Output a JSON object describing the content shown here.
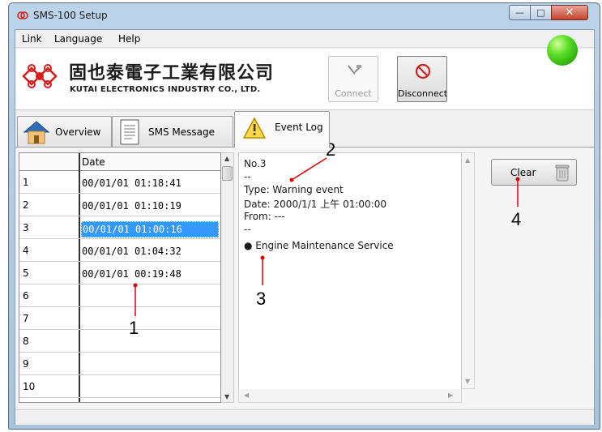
{
  "window": {
    "title": "SMS-100 Setup",
    "close_glyph": "✕",
    "min_glyph": "—",
    "max_glyph": "□"
  },
  "menu": {
    "items": [
      "Link",
      "Language",
      "Help"
    ]
  },
  "header": {
    "company_cn": "固也泰電子工業有限公司",
    "company_en": "KUTAI ELECTRONICS INDUSTRY CO., LTD.",
    "connect_label": "Connect",
    "disconnect_label": "Disconnect",
    "status_color": "#3fd11a"
  },
  "tabs": [
    {
      "label": "Overview",
      "icon": "house-icon"
    },
    {
      "label": "SMS Message",
      "icon": "document-icon"
    },
    {
      "label": "Event Log",
      "icon": "warning-icon",
      "active": true
    }
  ],
  "grid": {
    "column_header": "Date",
    "rows": [
      {
        "num": "1",
        "date": "00/01/01 01:18:41"
      },
      {
        "num": "2",
        "date": "00/01/01 01:10:19"
      },
      {
        "num": "3",
        "date": "00/01/01 01:00:16",
        "selected": true
      },
      {
        "num": "4",
        "date": "00/01/01 01:04:32"
      },
      {
        "num": "5",
        "date": "00/01/01 00:19:48"
      },
      {
        "num": "6",
        "date": ""
      },
      {
        "num": "7",
        "date": ""
      },
      {
        "num": "8",
        "date": ""
      },
      {
        "num": "9",
        "date": ""
      },
      {
        "num": "10",
        "date": ""
      }
    ]
  },
  "detail": {
    "lines": [
      "No.3",
      "--",
      "Type: Warning event",
      "Date: 2000/1/1 上午 01:00:00",
      "From: ---",
      "--",
      "● Engine Maintenance Service"
    ]
  },
  "clear_button": {
    "label": "Clear"
  },
  "annotations": [
    "1",
    "2",
    "3",
    "4"
  ],
  "colors": {
    "selection": "#3399ff",
    "annotation_line": "#e00000"
  }
}
